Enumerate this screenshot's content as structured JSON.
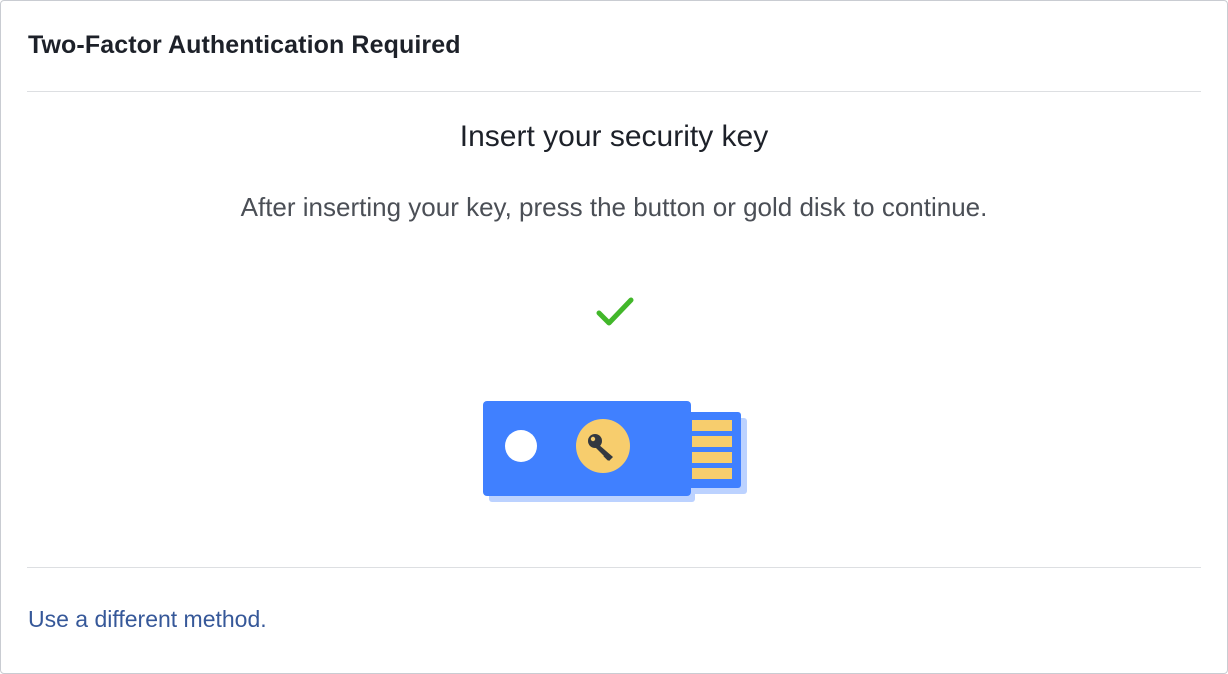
{
  "dialog": {
    "title": "Two-Factor Authentication Required"
  },
  "main": {
    "heading": "Insert your security key",
    "instructions": "After inserting your key, press the button or gold disk to continue.",
    "status_icon": "checkmark-icon",
    "illustration_icon": "usb-security-key-icon"
  },
  "footer": {
    "alternate_method_link": "Use a different method."
  },
  "colors": {
    "title_text": "#1d2129",
    "body_text": "#4b4f56",
    "link": "#365899",
    "checkmark": "#42b72a",
    "key_body": "#4080ff",
    "key_shadow": "#bcd2ff",
    "gold_disk": "#f7cd6d"
  }
}
